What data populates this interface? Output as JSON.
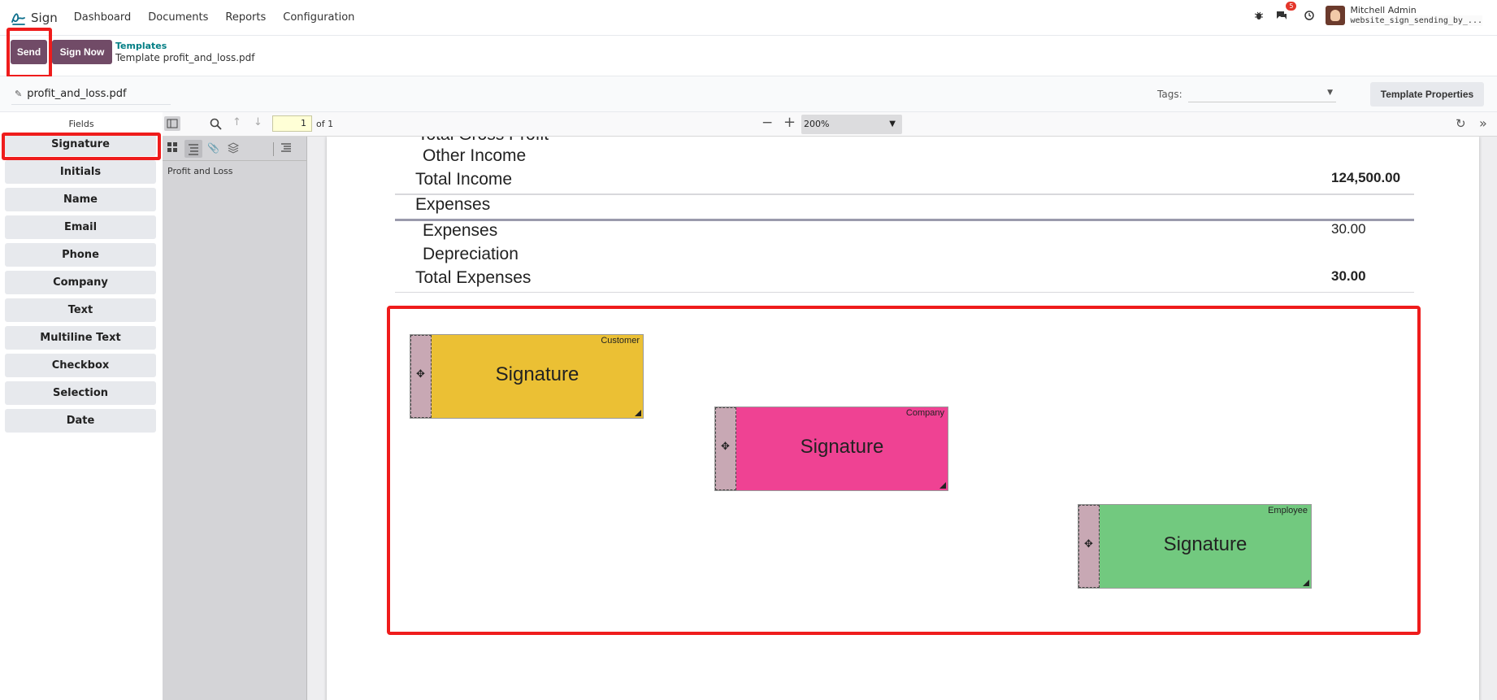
{
  "nav": {
    "app_name": "Sign",
    "menu": [
      "Dashboard",
      "Documents",
      "Reports",
      "Configuration"
    ],
    "notification_count": "5",
    "user_name": "Mitchell Admin",
    "database": "website_sign_sending_by_..."
  },
  "control_panel": {
    "send_label": "Send",
    "sign_now_label": "Sign Now",
    "breadcrumb_parent": "Templates",
    "breadcrumb_current": "Template profit_and_loss.pdf"
  },
  "doc_header": {
    "file_name": "profit_and_loss.pdf",
    "tags_label": "Tags:",
    "properties_button": "Template Properties"
  },
  "fields_panel": {
    "title": "Fields",
    "items": [
      "Signature",
      "Initials",
      "Name",
      "Email",
      "Phone",
      "Company",
      "Text",
      "Multiline Text",
      "Checkbox",
      "Selection",
      "Date"
    ]
  },
  "viewer": {
    "page_number": "1",
    "page_total": "of 1",
    "zoom": "200%",
    "outline_item": "Profit and Loss"
  },
  "document": {
    "rows": [
      {
        "label": "Total Gross Profit",
        "value": ""
      },
      {
        "label": "Other Income",
        "value": ""
      },
      {
        "label": "Total Income",
        "value": "124,500.00"
      },
      {
        "label": "Expenses",
        "value": ""
      },
      {
        "label": "Expenses",
        "value": "30.00"
      },
      {
        "label": "Depreciation",
        "value": ""
      },
      {
        "label": "Total Expenses",
        "value": "30.00"
      }
    ]
  },
  "signature_fields": [
    {
      "role": "Customer",
      "label": "Signature",
      "color": "#ebc034"
    },
    {
      "role": "Company",
      "label": "Signature",
      "color": "#ef4293"
    },
    {
      "role": "Employee",
      "label": "Signature",
      "color": "#72c97f"
    }
  ],
  "colors": {
    "primary": "#714b67",
    "highlight": "#ef1c1c",
    "link": "#017e84"
  }
}
